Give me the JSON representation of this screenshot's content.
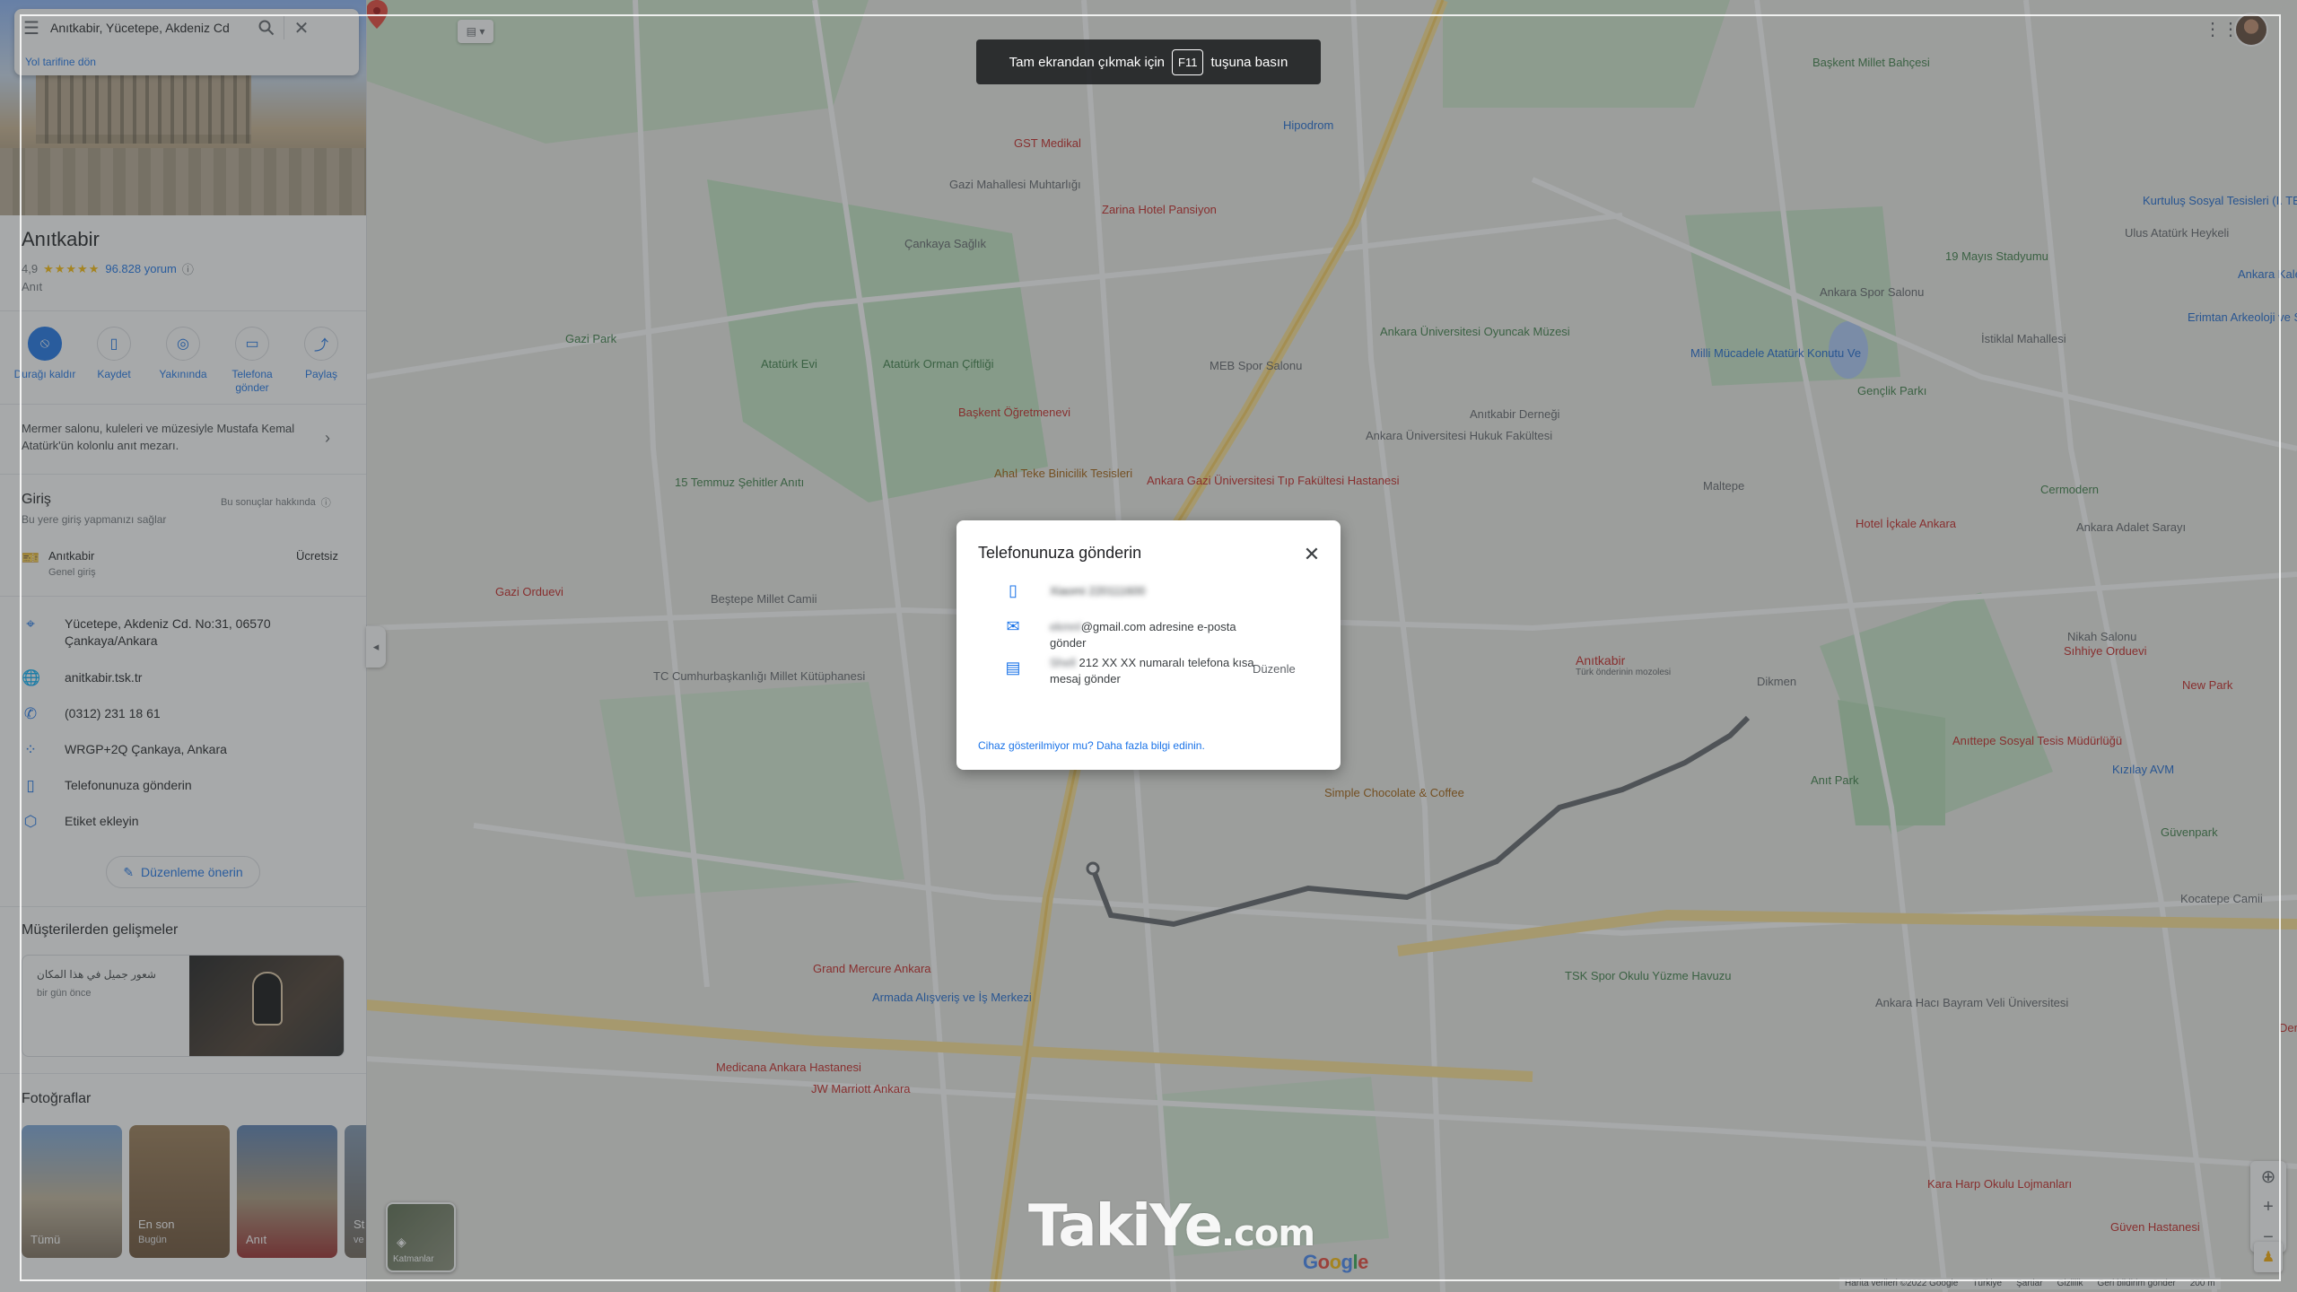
{
  "search": {
    "value": "Anıtkabir, Yücetepe, Akdeniz Cd",
    "back_link": "Yol tarifine dön"
  },
  "place": {
    "title": "Anıtkabir",
    "rating": "4,9",
    "stars": "★★★★★",
    "reviews": "96.828 yorum",
    "category": "Anıt",
    "description": "Mermer salonu, kuleleri ve müzesiyle Mustafa Kemal Atatürk'ün kolonlu anıt mezarı."
  },
  "actions": [
    {
      "label": "Durağı kaldır",
      "icon": "remove-stop-icon"
    },
    {
      "label": "Kaydet",
      "icon": "bookmark-icon"
    },
    {
      "label": "Yakınında",
      "icon": "nearby-icon"
    },
    {
      "label": "Telefona gönder",
      "icon": "send-to-phone-icon"
    },
    {
      "label": "Paylaş",
      "icon": "share-icon"
    }
  ],
  "entry": {
    "heading": "Giriş",
    "about": "Bu sonuçlar hakkında",
    "subtitle": "Bu yere giriş yapmanızı sağlar",
    "name": "Anıtkabir",
    "type": "Genel giriş",
    "price": "Ücretsiz"
  },
  "info": {
    "address": "Yücetepe, Akdeniz Cd. No:31, 06570 Çankaya/Ankara",
    "website": "anitkabir.tsk.tr",
    "phone": "(0312) 231 18 61",
    "plus_code": "WRGP+2Q Çankaya, Ankara",
    "send_to_phone": "Telefonunuza gönderin",
    "label": "Etiket ekleyin"
  },
  "suggest_edit": "Düzenleme önerin",
  "reviews_section": {
    "heading": "Müşterilerden gelişmeler",
    "text": "شعور جميل في هذا المكان",
    "date": "bir gün önce"
  },
  "photos_section": {
    "heading": "Fotoğraflar",
    "items": [
      {
        "label": "Tümü",
        "sub": ""
      },
      {
        "label": "En son",
        "sub": "Bugün"
      },
      {
        "label": "Anıt",
        "sub": ""
      },
      {
        "label": "St",
        "sub": "ve"
      }
    ]
  },
  "layers_label": "Katmanlar",
  "fullscreen_notice": {
    "before": "Tam ekrandan çıkmak için",
    "key": "F11",
    "after": "tuşuna basın"
  },
  "dialog": {
    "title": "Telefonunuza gönderin",
    "device": "Xiaomi 220111600",
    "email_prefix": "ekmnl",
    "email_suffix": "@gmail.com adresine e-posta gönder",
    "sms_prefix": "Shell",
    "sms_suffix": "212 XX XX numaralı telefona kısa mesaj gönder",
    "edit": "Düzenle",
    "help": "Cihaz gösterilmiyor mu? Daha fazla bilgi edinin."
  },
  "footer": [
    "Harita verileri ©2022 Google",
    "Türkiye",
    "Şartlar",
    "Gizlilik",
    "Geri bildirim gönder",
    "200 m"
  ],
  "watermark": {
    "main": "TakiYe",
    "tld": ".com"
  },
  "google_logo": "Google",
  "map_pin": {
    "name": "Anıtkabir",
    "sub": "Türk önderinin mozolesi"
  },
  "map_labels": [
    "Gazi Mahallesi Muhtarlığı",
    "Zarina Hotel Pansiyon",
    "GST Medikal",
    "Çankaya Sağlık",
    "Ankara Üniversitesi Oyuncak Müzesi",
    "Başkent Millet Bahçesi",
    "Kurtuluş Sosyal Tesisleri (I. TBMM Binası)",
    "Ulus Atatürk Heykeli",
    "19 Mayıs Stadyumu",
    "Ankara Spor Salonu",
    "Milli Mücadele Atatürk Konutu Ve",
    "Gençlik Parkı",
    "İstiklal Mahallesi",
    "Ankara Kalesi",
    "Erimtan Arkeoloji ve Sanat Müzesi",
    "Ankara Adalet Sarayı",
    "Hotel İçkale Ankara",
    "Cermodern",
    "Nikah Salonu",
    "Sıhhiye Orduevi",
    "New Park",
    "Kızılay AVM",
    "Güvenpark",
    "Kocatepe Camii",
    "Anıttepe Sosyal Tesis Müdürlüğü",
    "Anıt Park",
    "Simple Chocolate & Coffee",
    "Grand Mercure Ankara",
    "Armada Alışveriş ve İş Merkezi",
    "Medicana Ankara Hastanesi",
    "JW Marriott Ankara",
    "Ankara Hacı Bayram Veli Üniversitesi",
    "TSK Spor Okulu Yüzme Havuzu",
    "Demora",
    "Güven Hastanesi",
    "Kara Harp Okulu Lojmanları",
    "Başkent Öğretmenevi",
    "Ahal Teke Binicilik Tesisleri",
    "Atatürk Evi",
    "Gazi Park",
    "15 Temmuz Şehitler Anıtı",
    "Gazi Orduevi",
    "Beştepe Millet Camii",
    "TC Cumhurbaşkanlığı Millet Kütüphanesi",
    "Atatürk Orman Çiftliği",
    "Hipodrom",
    "Ankara Gazi Üniversitesi Tıp Fakültesi Hastanesi",
    "Ankara Üniversitesi Hukuk Fakültesi",
    "MEB Spor Salonu",
    "Anıtkabir Derneği",
    "Dikmen",
    "Maltepe"
  ]
}
